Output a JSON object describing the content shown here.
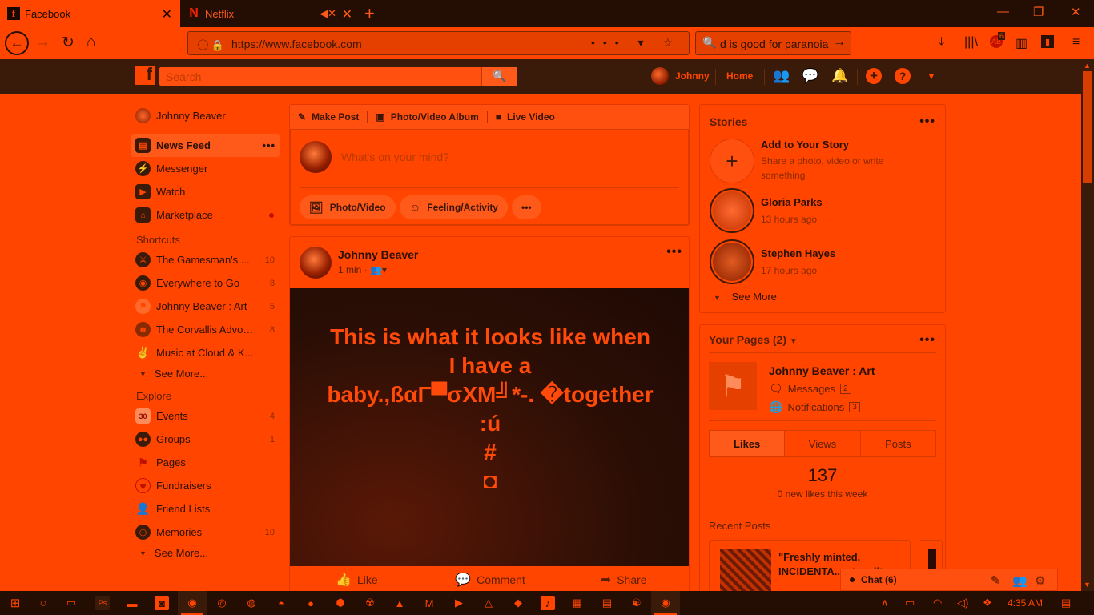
{
  "browser": {
    "tabs": [
      {
        "title": "Facebook",
        "favicon": "f"
      },
      {
        "title": "Netflix",
        "favicon": "N"
      }
    ],
    "url": "https://www.facebook.com",
    "search_text": "d is good for paranoia",
    "toolbar_badge_1": "6"
  },
  "fb": {
    "search_placeholder": "Search",
    "user_name": "Johnny",
    "home_label": "Home"
  },
  "sidebar": {
    "profile": "Johnny Beaver",
    "main": [
      {
        "label": "News Feed"
      },
      {
        "label": "Messenger"
      },
      {
        "label": "Watch"
      },
      {
        "label": "Marketplace"
      }
    ],
    "shortcuts_heading": "Shortcuts",
    "shortcuts": [
      {
        "label": "The Gamesman's ...",
        "count": "10"
      },
      {
        "label": "Everywhere to Go",
        "count": "8"
      },
      {
        "label": "Johnny Beaver : Art",
        "count": "5"
      },
      {
        "label": "The Corvallis Advoc...",
        "count": "8"
      },
      {
        "label": "Music at Cloud & K...",
        "count": ""
      }
    ],
    "see_more": "See More...",
    "explore_heading": "Explore",
    "explore": [
      {
        "label": "Events",
        "count": "4",
        "icon": "30"
      },
      {
        "label": "Groups",
        "count": "1"
      },
      {
        "label": "Pages",
        "count": ""
      },
      {
        "label": "Fundraisers",
        "count": ""
      },
      {
        "label": "Friend Lists",
        "count": ""
      },
      {
        "label": "Memories",
        "count": "10"
      }
    ]
  },
  "composer": {
    "tab_make_post": "Make Post",
    "tab_album": "Photo/Video Album",
    "tab_live": "Live Video",
    "placeholder": "What's on your mind?",
    "btn_photo": "Photo/Video",
    "btn_feeling": "Feeling/Activity"
  },
  "post": {
    "author": "Johnny Beaver",
    "time": "1 min",
    "lines": [
      "This is what it looks like when",
      "I have a",
      "baby.,ßαΓ▀σXM╝*-. �together",
      ":ú",
      "#",
      "◘"
    ],
    "like": "Like",
    "comment": "Comment",
    "share": "Share"
  },
  "stories": {
    "heading": "Stories",
    "add_title": "Add to Your Story",
    "add_sub": "Share a photo, video or write something",
    "items": [
      {
        "name": "Gloria Parks",
        "time": "13 hours ago"
      },
      {
        "name": "Stephen Hayes",
        "time": "17 hours ago"
      }
    ],
    "see_more": "See More"
  },
  "your_pages": {
    "heading": "Your Pages (2)",
    "page_name": "Johnny Beaver : Art",
    "messages_label": "Messages",
    "messages_count": "2",
    "notifications_label": "Notifications",
    "notifications_count": "3",
    "tabs": [
      "Likes",
      "Views",
      "Posts"
    ],
    "likes_total": "137",
    "likes_sub": "0 new likes this week",
    "recent_heading": "Recent Posts",
    "recent_post": "\"Freshly minted, INCIDENTA... at auditory"
  },
  "chat": {
    "label": "Chat (6)"
  },
  "taskbar": {
    "time": "4:35 AM"
  },
  "colors": {
    "accent": "#ff4500",
    "dark": "#240d03"
  }
}
